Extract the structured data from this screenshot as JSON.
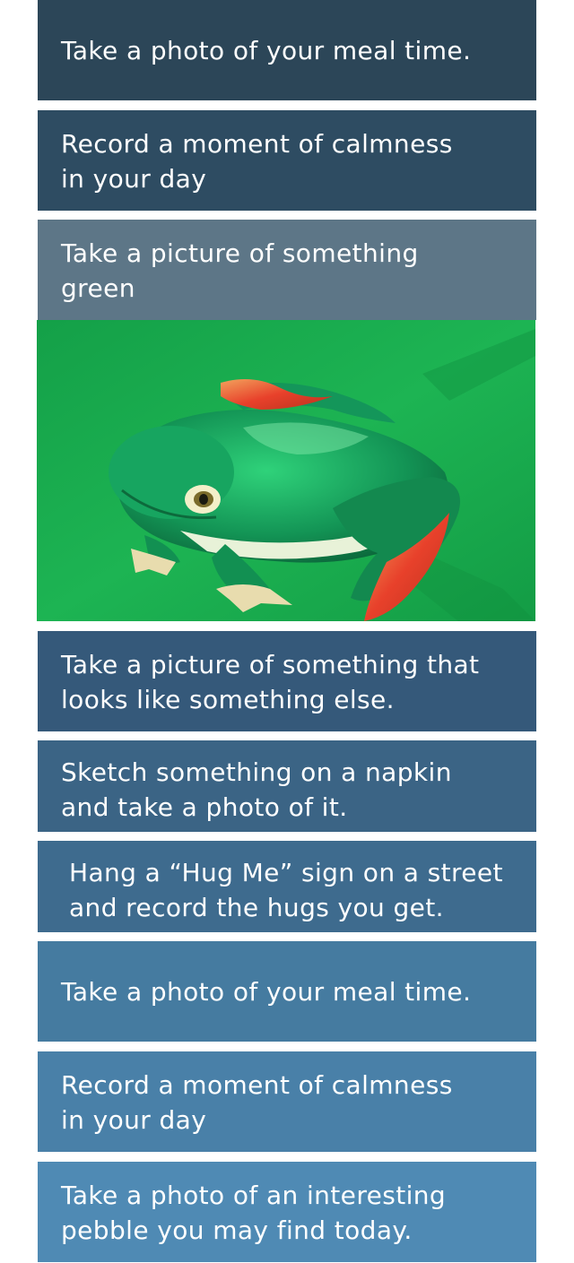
{
  "cards": [
    {
      "text": "Take a photo of your meal time.",
      "color": "#2c4658"
    },
    {
      "line1": "Record a moment of calmness",
      "line2": "in your day",
      "color": "#2e4c62"
    },
    {
      "line1": "Take a picture of something",
      "line2": "green",
      "color": "#5d7687"
    },
    {
      "line1": "Take a picture of something that",
      "line2": "looks like something else.",
      "color": "#35597a"
    },
    {
      "line1": "Sketch something on a napkin",
      "line2": "and take a photo of it.",
      "color": "#3b6485"
    },
    {
      "line1": "Hang a “Hug Me” sign on a street",
      "line2": "and record the hugs you get.",
      "color": "#3e6b8e"
    },
    {
      "text": "Take a photo of your meal time.",
      "color": "#457ba0"
    },
    {
      "line1": "Record a moment of calmness",
      "line2": "in your day",
      "color": "#4980a8"
    },
    {
      "line1": "Take a photo of an interesting",
      "line2": "pebble you may find today.",
      "color": "#4f8ab4"
    }
  ],
  "photo": {
    "subject": "green-tree-frog",
    "background_color": "#16a54b"
  }
}
